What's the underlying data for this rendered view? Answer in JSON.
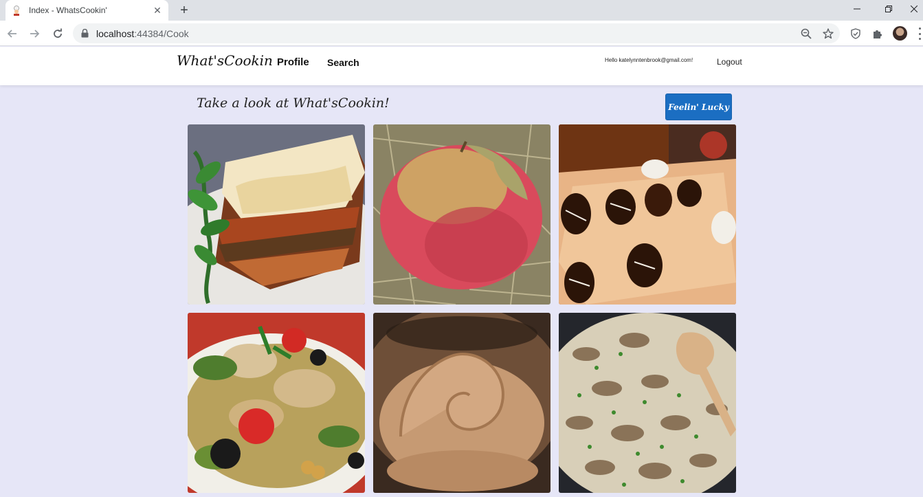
{
  "browser": {
    "tab_title": "Index - WhatsCookin'",
    "url_host": "localhost",
    "url_port_path": ":44384/Cook",
    "window_controls": [
      "minimize",
      "restore",
      "close"
    ]
  },
  "navbar": {
    "brand": "What'sCookin",
    "links": [
      "Profile",
      "Search"
    ],
    "greeting": "Hello katelynntenbrook@gmail.com!",
    "logout": "Logout"
  },
  "main": {
    "heading": "Take a look at What'sCookin!",
    "lucky_button": "Feelin' Lucky",
    "recipes": [
      {
        "image": "lasagna-photo"
      },
      {
        "image": "apple-photo"
      },
      {
        "image": "chocolate-strawberries-photo"
      },
      {
        "image": "chicken-vegetable-salad-photo"
      },
      {
        "image": "peanut-butter-photo"
      },
      {
        "image": "mushroom-stroganoff-photo"
      }
    ]
  },
  "colors": {
    "page_background": "#e6e6f7",
    "lucky_button": "#1b6ec2"
  }
}
